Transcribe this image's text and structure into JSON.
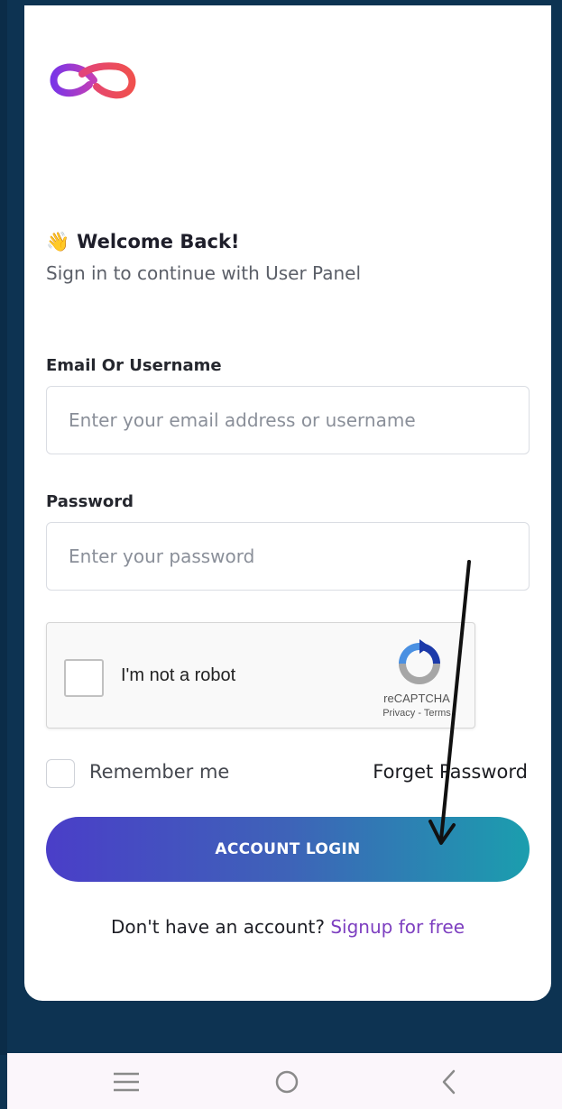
{
  "header": {
    "logo_icon": "infinity-logo-icon"
  },
  "welcome": {
    "emoji": "👋",
    "title": "Welcome Back!",
    "subtitle": "Sign in to continue with User Panel"
  },
  "form": {
    "email_label": "Email Or Username",
    "email_placeholder": "Enter your email address or username",
    "email_value": "",
    "password_label": "Password",
    "password_placeholder": "Enter your password",
    "password_value": ""
  },
  "recaptcha": {
    "label": "I'm not a robot",
    "brand": "reCAPTCHA",
    "links": "Privacy - Terms",
    "checked": false
  },
  "options": {
    "remember_label": "Remember me",
    "remember_checked": false,
    "forget_label": "Forget Password"
  },
  "login": {
    "button_label": "ACCOUNT LOGIN"
  },
  "signup": {
    "prompt": "Don't have an account?",
    "link": "Signup for free"
  },
  "navbar": {
    "icons": [
      "menu-icon",
      "home-icon",
      "back-icon"
    ]
  },
  "colors": {
    "background": "#0d3352",
    "button_gradient_start": "#4a3ec8",
    "button_gradient_end": "#1b9eae",
    "link": "#7d3fc0"
  }
}
